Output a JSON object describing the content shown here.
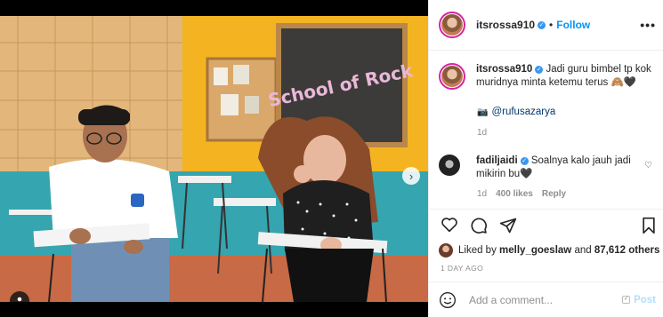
{
  "photo": {
    "chalkboard_text": "School of Rock",
    "carousel_total": 3,
    "carousel_active": 1
  },
  "header": {
    "username": "itsrossa910",
    "separator": "•",
    "follow_label": "Follow",
    "more_icon": "more-options-icon"
  },
  "caption": {
    "username": "itsrossa910",
    "text": "Jadi guru bimbel tp kok muridnya minta ketemu terus 🙈🖤",
    "credit_handle": "@rufusazarya",
    "time": "1d"
  },
  "comment": {
    "username": "fadiljaidi",
    "text": "Soalnya kalo jauh jadi mikirin bu🖤",
    "time": "1d",
    "likes": "400 likes",
    "reply_label": "Reply"
  },
  "likes": {
    "prefix": "Liked by ",
    "first_liker": "melly_goeslaw",
    "middle": " and ",
    "others": "87,612 others"
  },
  "time_ago": "1 DAY AGO",
  "comment_box": {
    "placeholder": "Add a comment...",
    "post_label": "Post"
  },
  "colors": {
    "accent": "#0095f6",
    "verified": "#3897f0",
    "muted": "#8e8e8e",
    "text": "#262626"
  }
}
